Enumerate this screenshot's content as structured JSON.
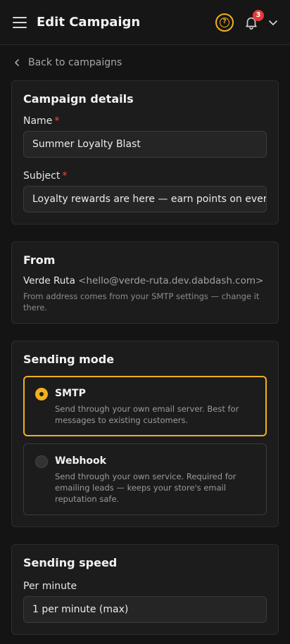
{
  "header": {
    "title": "Edit Campaign",
    "notification_count": "3",
    "accent": "#f2b01e"
  },
  "back_link": {
    "label": "Back to campaigns"
  },
  "details": {
    "title": "Campaign details",
    "name_label": "Name",
    "name_value": "Summer Loyalty Blast",
    "subject_label": "Subject",
    "subject_value": "Loyalty rewards are here — earn points on every",
    "required_mark": "*"
  },
  "from": {
    "title": "From",
    "sender_name": "Verde Ruta",
    "sender_email": "<hello@verde-ruta.dev.dabdash.com>",
    "hint": "From address comes from your SMTP settings — change it there."
  },
  "sending_mode": {
    "title": "Sending mode",
    "options": [
      {
        "label": "SMTP",
        "description": "Send through your own email server. Best for messages to existing customers.",
        "selected": true
      },
      {
        "label": "Webhook",
        "description": "Send through your own service. Required for emailing leads — keeps your store's email reputation safe.",
        "selected": false
      }
    ]
  },
  "sending_speed": {
    "title": "Sending speed",
    "per_minute_label": "Per minute",
    "per_minute_value": "1 per minute (max)"
  }
}
